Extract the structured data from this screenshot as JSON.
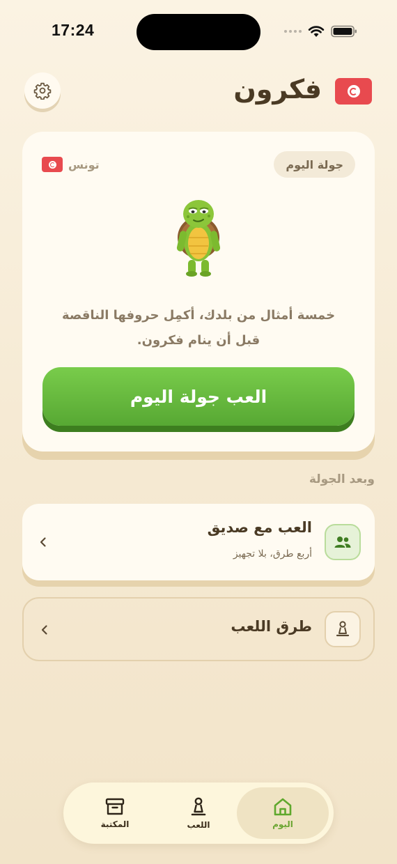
{
  "status_bar": {
    "time": "17:24"
  },
  "header": {
    "title": "فكرون",
    "settings_icon": "gear-icon",
    "flag_icon": "tunisia-flag-icon"
  },
  "today_card": {
    "badge": "جولة اليوم",
    "country": "تونس",
    "mascot": "turtle-mascot",
    "description": "خمسة أمثال من بلدك، أكمِل حروفها الناقصة قبل أن ينام فكرون.",
    "play_label": "العب جولة اليوم"
  },
  "after_round": {
    "section_label": "وبعد الجولة",
    "friend": {
      "title": "العب مع صديق",
      "subtitle": "أربع طرق، بلا تجهيز",
      "icon": "users-icon"
    },
    "ways": {
      "title": "طرق اللعب",
      "icon": "pawn-icon"
    }
  },
  "tabbar": {
    "items": [
      {
        "label": "اليوم",
        "icon": "home-icon",
        "active": true
      },
      {
        "label": "اللعب",
        "icon": "pawn-icon",
        "active": false
      },
      {
        "label": "المكتبة",
        "icon": "archive-icon",
        "active": false
      }
    ]
  },
  "colors": {
    "accent_green": "#5db236",
    "flag_red": "#e84a4f",
    "background": "#f7ecd7"
  }
}
